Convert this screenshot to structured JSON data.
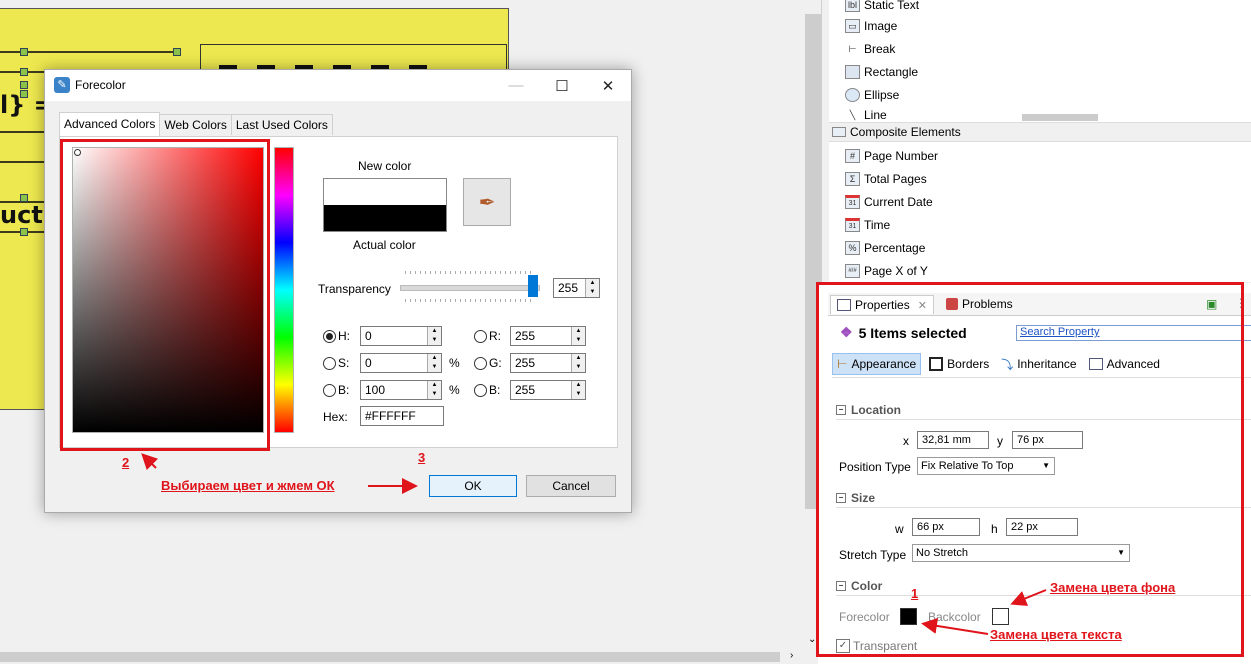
{
  "report": {
    "big_text_1": "l} ==",
    "big_text_2": "uctS"
  },
  "palette": {
    "items": [
      {
        "icon": "label-icon",
        "label": "Static Text"
      },
      {
        "icon": "image-icon",
        "label": "Image"
      },
      {
        "icon": "break-icon",
        "label": "Break"
      },
      {
        "icon": "rectangle-icon",
        "label": "Rectangle"
      },
      {
        "icon": "ellipse-icon",
        "label": "Ellipse"
      },
      {
        "icon": "line-icon",
        "label": "Line"
      }
    ],
    "category": "Composite Elements",
    "composite_items": [
      {
        "icon": "hash-icon",
        "glyph": "#",
        "label": "Page Number"
      },
      {
        "icon": "sigma-icon",
        "glyph": "Σ",
        "label": "Total Pages"
      },
      {
        "icon": "calendar-icon",
        "glyph": "31",
        "label": "Current Date"
      },
      {
        "icon": "calendar-time-icon",
        "glyph": "31",
        "label": "Time"
      },
      {
        "icon": "percent-icon",
        "glyph": "%",
        "label": "Percentage"
      },
      {
        "icon": "page-x-of-y-icon",
        "glyph": "#/#",
        "label": "Page X of Y"
      }
    ]
  },
  "properties": {
    "tab_properties": "Properties",
    "tab_problems": "Problems",
    "selection_title": "5 Items selected",
    "search_placeholder": "Search Property",
    "subtabs": [
      "Appearance",
      "Borders",
      "Inheritance",
      "Advanced"
    ],
    "location": {
      "section": "Location",
      "x_label": "x",
      "x_value": "32,81 mm",
      "y_label": "y",
      "y_value": "76 px",
      "position_type_label": "Position Type",
      "position_type_value": "Fix Relative To Top"
    },
    "size": {
      "section": "Size",
      "w_label": "w",
      "w_value": "66 px",
      "h_label": "h",
      "h_value": "22 px",
      "stretch_label": "Stretch Type",
      "stretch_value": "No Stretch"
    },
    "color": {
      "section": "Color",
      "forecolor_label": "Forecolor",
      "backcolor_label": "Backcolor",
      "forecolor": "#000000",
      "backcolor": "#ffffff",
      "transparent_label": "Transparent"
    }
  },
  "dialog": {
    "title": "Forecolor",
    "tabs": [
      "Advanced Colors",
      "Web Colors",
      "Last Used Colors"
    ],
    "new_color_label": "New color",
    "actual_color_label": "Actual color",
    "transparency_label": "Transparency",
    "transparency_value": "255",
    "h_label": "H:",
    "h_value": "0",
    "s_label": "S:",
    "s_value": "0",
    "b_label": "B:",
    "b_value": "100",
    "r_label": "R:",
    "r_value": "255",
    "g_label": "G:",
    "g_value": "255",
    "bb_label": "B:",
    "bb_value": "255",
    "percent": "%",
    "hex_label": "Hex:",
    "hex_value": "#FFFFFF",
    "ok": "OK",
    "cancel": "Cancel"
  },
  "annotations": {
    "n1": "1",
    "n2": "2",
    "n3": "3",
    "choose_ok": "Выбираем цвет и жмем ОК",
    "bg_change": "Замена цвета фона",
    "text_change": "Замена цвета текста"
  },
  "colors": {
    "accent_red": "#e0141b",
    "selection_blue": "#0078d7"
  }
}
